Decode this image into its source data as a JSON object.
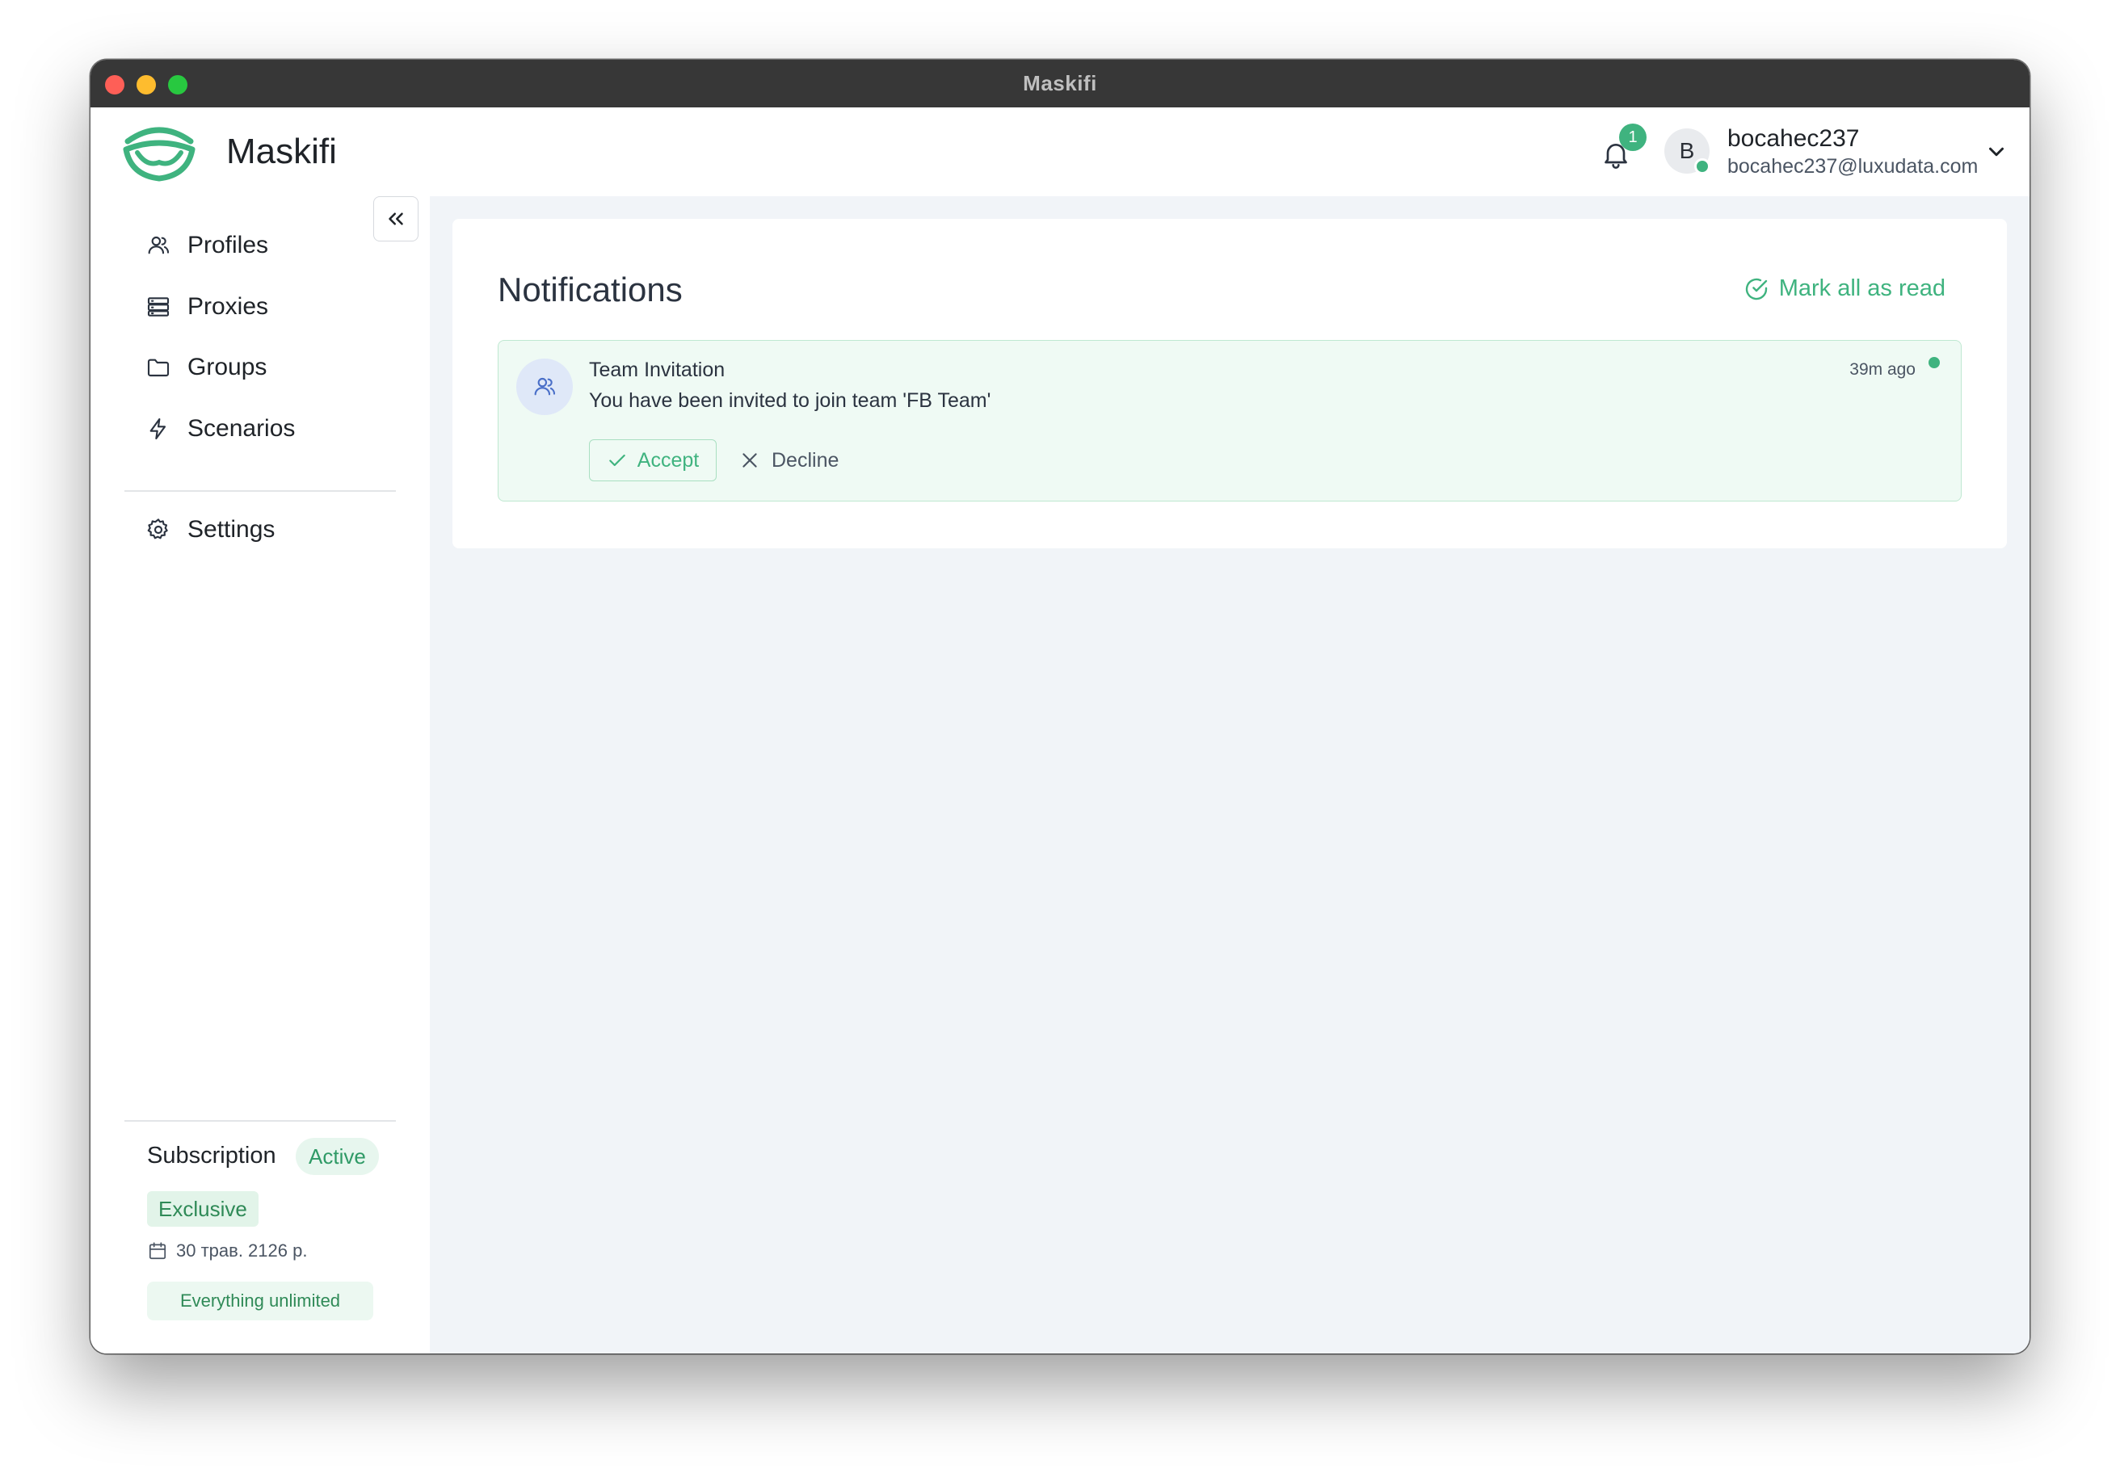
{
  "window": {
    "title": "Maskifi"
  },
  "header": {
    "brand": "Maskifi",
    "notification_count": "1",
    "user": {
      "initial": "B",
      "name": "bocahec237",
      "email": "bocahec237@luxudata.com"
    }
  },
  "sidebar": {
    "items": [
      {
        "label": "Profiles",
        "icon": "users-icon"
      },
      {
        "label": "Proxies",
        "icon": "server-icon"
      },
      {
        "label": "Groups",
        "icon": "folder-icon"
      },
      {
        "label": "Scenarios",
        "icon": "lightning-icon"
      },
      {
        "label": "Settings",
        "icon": "gear-icon"
      }
    ],
    "subscription": {
      "title": "Subscription",
      "status": "Active",
      "plan": "Exclusive",
      "date": "30 трав. 2126 р.",
      "feature": "Everything unlimited"
    }
  },
  "main": {
    "title": "Notifications",
    "mark_all_label": "Mark all as read",
    "notifications": [
      {
        "title": "Team Invitation",
        "message": "You have been invited to join team 'FB Team'",
        "time": "39m ago",
        "accept_label": "Accept",
        "decline_label": "Decline",
        "unread": true
      }
    ]
  },
  "colors": {
    "accent": "#3fb37f",
    "titlebar": "#373737",
    "content_bg": "#f1f4f8",
    "notification_bg": "#effaf4"
  }
}
